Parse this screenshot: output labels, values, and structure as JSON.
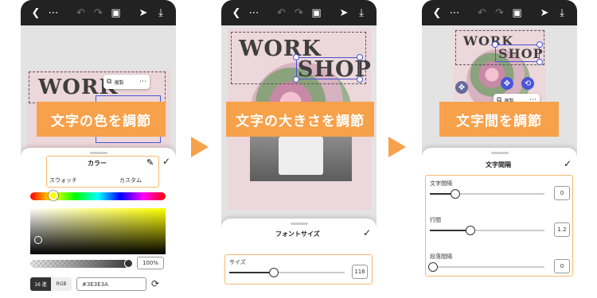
{
  "colors": {
    "accent": "#f7a14a",
    "selection": "#4a55d8",
    "topbar": "#222222",
    "doc_bg": "#ecd7da",
    "title_text": "#3e3e3e"
  },
  "toolbar_icons": [
    "back-icon",
    "more-icon",
    "undo-icon",
    "redo-icon",
    "layers-icon",
    "send-icon",
    "download-icon"
  ],
  "document": {
    "title_work": "WORK",
    "title_shop": "SHOP"
  },
  "chip": {
    "duplicate_label": "複製"
  },
  "panels": [
    {
      "banner": "文字の色を調節"
    },
    {
      "banner": "文字の大きさを調節"
    },
    {
      "banner": "文字間を調節"
    }
  ],
  "color_panel": {
    "title": "カラー",
    "tab_swatch": "スウォッチ",
    "tab_custom": "カスタム",
    "opacity": "100%",
    "mode_hex": "16 進",
    "mode_rgb": "RGB",
    "hex_value": "#3E3E3A"
  },
  "font_panel": {
    "title": "フォントサイズ",
    "size_label": "サイズ",
    "size_value": "116"
  },
  "spacing_panel": {
    "title": "文字間隔",
    "letter_label": "文字間隔",
    "letter_value": "0",
    "line_label": "行間",
    "line_value": "1.2",
    "para_label": "段落間隔",
    "para_value": "0"
  },
  "sliders": {
    "hue": 0.14,
    "opacity": 1.0,
    "font_size": 0.38,
    "letter_spacing": 0.22,
    "line_height": 0.35,
    "paragraph": 0.0
  }
}
